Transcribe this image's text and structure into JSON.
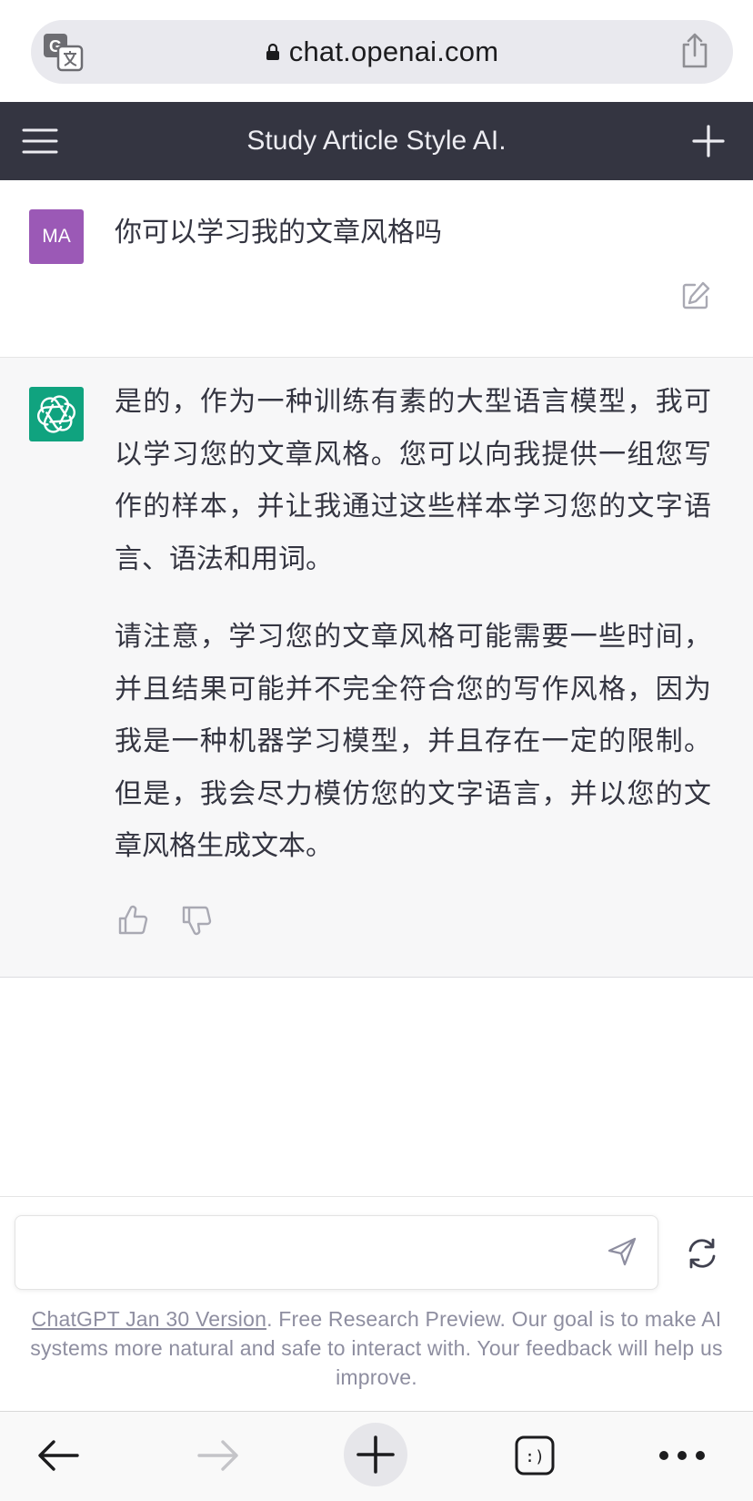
{
  "browser": {
    "url": "chat.openai.com",
    "icons": {
      "translate": "translate-icon",
      "lock": "lock-icon",
      "share": "share-icon"
    }
  },
  "header": {
    "title": "Study Article Style AI.",
    "icons": {
      "menu": "menu-icon",
      "new_chat": "plus-icon"
    }
  },
  "conversation": {
    "user_message": {
      "avatar_initials": "MA",
      "avatar_color": "#9b59b6",
      "text": "你可以学习我的文章风格吗"
    },
    "assistant_message": {
      "avatar_color": "#10a37f",
      "paragraphs": [
        "是的，作为一种训练有素的大型语言模型，我可以学习您的文章风格。您可以向我提供一组您写作的样本，并让我通过这些样本学习您的文字语言、语法和用词。",
        "请注意，学习您的文章风格可能需要一些时间，并且结果可能并不完全符合您的写作风格，因为我是一种机器学习模型，并且存在一定的限制。但是，我会尽力模仿您的文字语言，并以您的文章风格生成文本。"
      ]
    }
  },
  "composer": {
    "input_value": "",
    "input_placeholder": "",
    "disclaimer_link": "ChatGPT Jan 30 Version",
    "disclaimer_text": ". Free Research Preview. Our goal is to make AI systems more natural and safe to interact with. Your feedback will help us improve."
  },
  "toolbar": {
    "tabs_label": ":)"
  },
  "colors": {
    "header_bg": "#343541",
    "assistant_bg": "#f7f7f8",
    "brand_green": "#10a37f"
  }
}
